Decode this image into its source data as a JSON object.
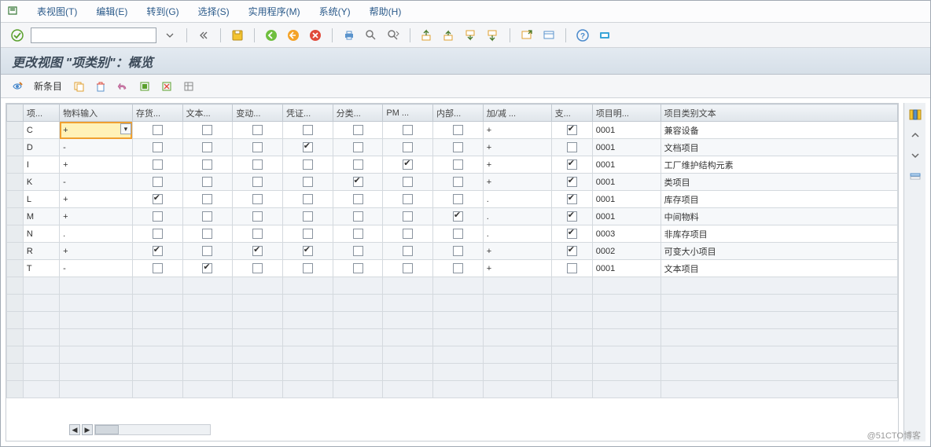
{
  "menu": {
    "items": [
      "表视图(T)",
      "编辑(E)",
      "转到(G)",
      "选择(S)",
      "实用程序(M)",
      "系统(Y)",
      "帮助(H)"
    ]
  },
  "app_title": "更改视图 \"项类别\"：概览",
  "subtoolbar": {
    "new_entries": "新条目"
  },
  "columns": [
    "项...",
    "物料输入",
    "存货...",
    "文本...",
    "变动...",
    "凭证...",
    "分类...",
    "PM ...",
    "内部...",
    "加/减 ...",
    "支...",
    "项目明...",
    "项目类别文本"
  ],
  "rows": [
    {
      "code": "C",
      "mat": "+",
      "c1": false,
      "c2": false,
      "c3": false,
      "c4": false,
      "c5": false,
      "c6": false,
      "c7": false,
      "pm": "+",
      "sp": true,
      "pn": "0001",
      "txt": "兼容设备",
      "first_active": true
    },
    {
      "code": "D",
      "mat": "-",
      "c1": false,
      "c2": false,
      "c3": false,
      "c4": true,
      "c5": false,
      "c6": false,
      "c7": false,
      "pm": "+",
      "sp": false,
      "pn": "0001",
      "txt": "文档项目"
    },
    {
      "code": "I",
      "mat": "+",
      "c1": false,
      "c2": false,
      "c3": false,
      "c4": false,
      "c5": false,
      "c6": true,
      "c7": false,
      "pm": "+",
      "sp": true,
      "pn": "0001",
      "txt": "工厂维护结构元素"
    },
    {
      "code": "K",
      "mat": "-",
      "c1": false,
      "c2": false,
      "c3": false,
      "c4": false,
      "c5": true,
      "c6": false,
      "c7": false,
      "pm": "+",
      "sp": true,
      "pn": "0001",
      "txt": "类项目"
    },
    {
      "code": "L",
      "mat": "+",
      "c1": true,
      "c2": false,
      "c3": false,
      "c4": false,
      "c5": false,
      "c6": false,
      "c7": false,
      "pm": ".",
      "sp": true,
      "pn": "0001",
      "txt": "库存项目"
    },
    {
      "code": "M",
      "mat": "+",
      "c1": false,
      "c2": false,
      "c3": false,
      "c4": false,
      "c5": false,
      "c6": false,
      "c7": true,
      "pm": ".",
      "sp": true,
      "pn": "0001",
      "txt": "中间物料"
    },
    {
      "code": "N",
      "mat": ".",
      "c1": false,
      "c2": false,
      "c3": false,
      "c4": false,
      "c5": false,
      "c6": false,
      "c7": false,
      "pm": ".",
      "sp": true,
      "pn": "0003",
      "txt": "非库存项目"
    },
    {
      "code": "R",
      "mat": "+",
      "c1": true,
      "c2": false,
      "c3": true,
      "c4": true,
      "c5": false,
      "c6": false,
      "c7": false,
      "pm": "+",
      "sp": true,
      "pn": "0002",
      "txt": "可变大小项目"
    },
    {
      "code": "T",
      "mat": "-",
      "c1": false,
      "c2": true,
      "c3": false,
      "c4": false,
      "c5": false,
      "c6": false,
      "c7": false,
      "pm": "+",
      "sp": false,
      "pn": "0001",
      "txt": "文本项目"
    }
  ],
  "empty_rows": 7,
  "watermark": "@51CTO博客"
}
